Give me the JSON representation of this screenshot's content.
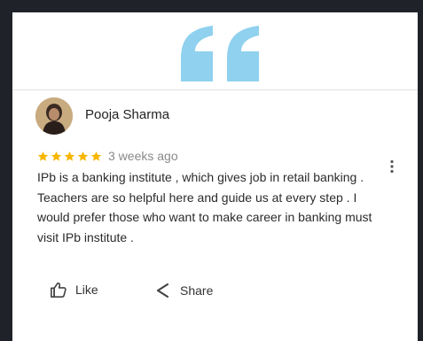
{
  "review": {
    "name": "Pooja Sharma",
    "rating": 5,
    "time": "3 weeks ago",
    "text": "IPb is a banking institute , which gives job in retail banking . Teachers are so helpful here and guide us at every step . I would prefer those who want to make career in banking must visit IPb institute ."
  },
  "actions": {
    "like_label": "Like",
    "share_label": "Share"
  },
  "colors": {
    "quote": "#8fd1ee",
    "star": "#f6b600",
    "background": "#1f2229",
    "card": "#ffffff"
  },
  "icons": [
    "quote-icon",
    "star-icon",
    "more-vert-icon",
    "thumbs-up-icon",
    "share-icon"
  ]
}
